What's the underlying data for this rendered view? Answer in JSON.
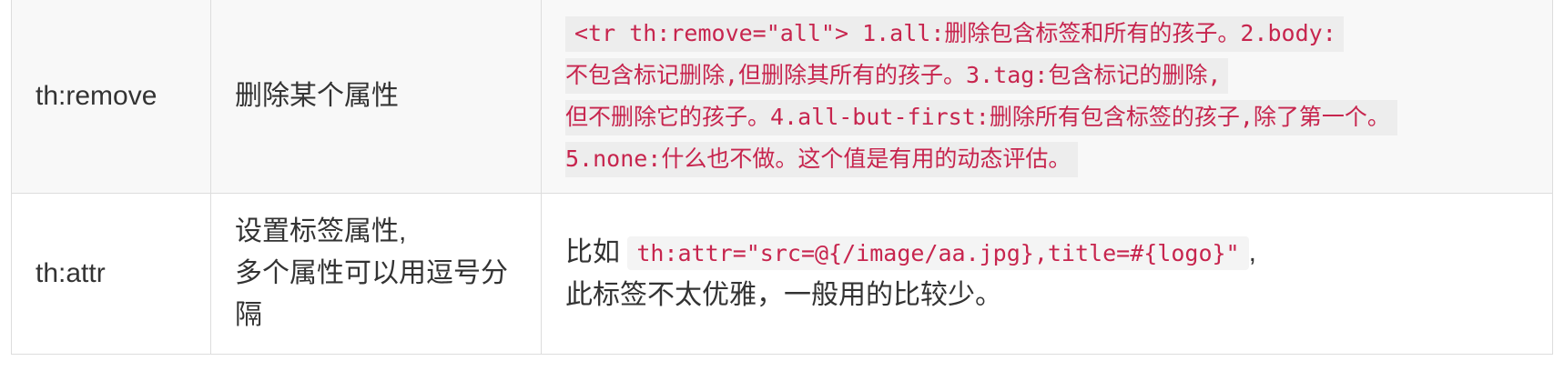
{
  "rows": [
    {
      "attribute": "th:remove",
      "description": "删除某个属性",
      "detail_code_lines": [
        "<tr th:remove=\"all\"> 1.all:删除包含标签和所有的孩子。2.body:",
        "不包含标记删除,但删除其所有的孩子。3.tag:包含标记的删除,",
        "但不删除它的孩子。4.all-but-first:删除所有包含标签的孩子,除了第一个。",
        "5.none:什么也不做。这个值是有用的动态评估。"
      ]
    },
    {
      "attribute": "th:attr",
      "description_lines": [
        "设置标签属性,",
        "多个属性可以用逗号分",
        "隔"
      ],
      "detail_prefix": "比如",
      "detail_code": "th:attr=\"src=@{/image/aa.jpg},title=#{logo}\"",
      "detail_suffix": ",",
      "detail_second_line": "此标签不太优雅，一般用的比较少。"
    }
  ],
  "colors": {
    "code_text": "#c7254e",
    "code_background": "#ededed",
    "border": "#dddddd",
    "striped_row": "#f8f8f8",
    "text": "#333333"
  }
}
